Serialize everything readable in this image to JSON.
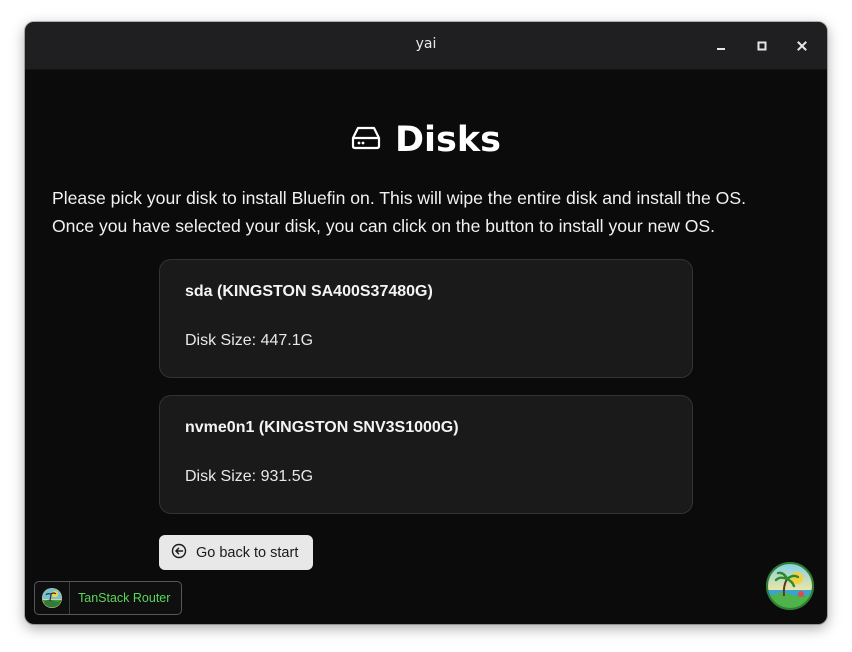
{
  "window": {
    "title": "yai",
    "controls": [
      "minimize-icon",
      "maximize-icon",
      "close-icon"
    ]
  },
  "page": {
    "heading_icon": "hard-drive-icon",
    "heading": "Disks",
    "description_lines": [
      "Please pick your disk to install Bluefin on. This will wipe the entire disk and install the OS.",
      "Once you have selected your disk, you can click on the button to install your new OS."
    ]
  },
  "disks": [
    {
      "name": "sda (KINGSTON SA400S37480G)",
      "size": "Disk Size: 447.1G"
    },
    {
      "name": "nvme0n1 (KINGSTON SNV3S1000G)",
      "size": "Disk Size: 931.5G"
    }
  ],
  "back_button": {
    "icon": "arrow-left-circle-icon",
    "label": "Go back to start"
  },
  "devtools": {
    "icon": "tanstack-logo-icon",
    "label": "TanStack Router"
  },
  "corner_logo": {
    "icon": "tropical-island-logo-icon"
  },
  "colors": {
    "background": "#0b0b0c",
    "titlebar": "#1f1f21",
    "card": "#1a1a1b",
    "button": "#e8e8e8",
    "tanstack_green": "#5ad65a"
  }
}
